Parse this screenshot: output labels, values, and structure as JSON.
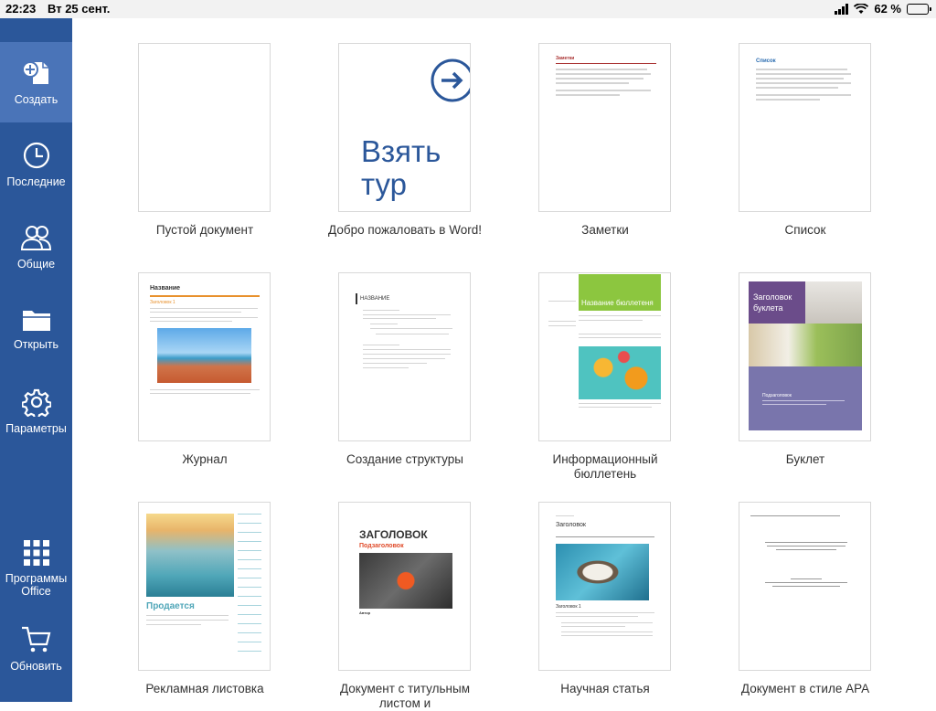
{
  "status": {
    "time": "22:23",
    "date": "Вт 25 сент.",
    "battery": "62 %",
    "battery_level": 0.62
  },
  "sidebar": {
    "items": [
      {
        "label": "Создать",
        "icon": "new-document-icon"
      },
      {
        "label": "Последние",
        "icon": "clock-icon"
      },
      {
        "label": "Общие",
        "icon": "people-icon"
      },
      {
        "label": "Открыть",
        "icon": "folder-icon"
      },
      {
        "label": "Параметры",
        "icon": "gear-icon"
      },
      {
        "label": "Программы Office",
        "icon": "apps-grid-icon"
      },
      {
        "label": "Обновить",
        "icon": "cart-icon"
      }
    ]
  },
  "templates": [
    {
      "name": "Пустой документ"
    },
    {
      "name": "Добро пожаловать в Word!",
      "thumb_text": "Взять тур"
    },
    {
      "name": "Заметки",
      "thumb_title": "Заметки"
    },
    {
      "name": "Список",
      "thumb_title": "Список"
    },
    {
      "name": "Журнал",
      "thumb_title": "Название",
      "thumb_heading": "Заголовок 1"
    },
    {
      "name": "Создание структуры",
      "thumb_title": "НАЗВАНИЕ"
    },
    {
      "name": "Информационный бюллетень",
      "thumb_title": "Название бюллетеня"
    },
    {
      "name": "Буклет",
      "thumb_title": "Заголовок буклета",
      "thumb_sub": "Подзаголовок"
    },
    {
      "name": "Рекламная листовка",
      "thumb_title": "Продается"
    },
    {
      "name": "Документ с титульным листом и",
      "thumb_title": "ЗАГОЛОВОК",
      "thumb_sub": "Подзаголовок",
      "thumb_author": "Автор"
    },
    {
      "name": "Научная статья",
      "thumb_title": "Заголовок",
      "thumb_heading": "Заголовок 1"
    },
    {
      "name": "Документ в стиле APA"
    }
  ],
  "colors": {
    "sidebar": "#2b579a",
    "sidebar_active": "#4a74b8",
    "word_blue": "#2b579a"
  }
}
